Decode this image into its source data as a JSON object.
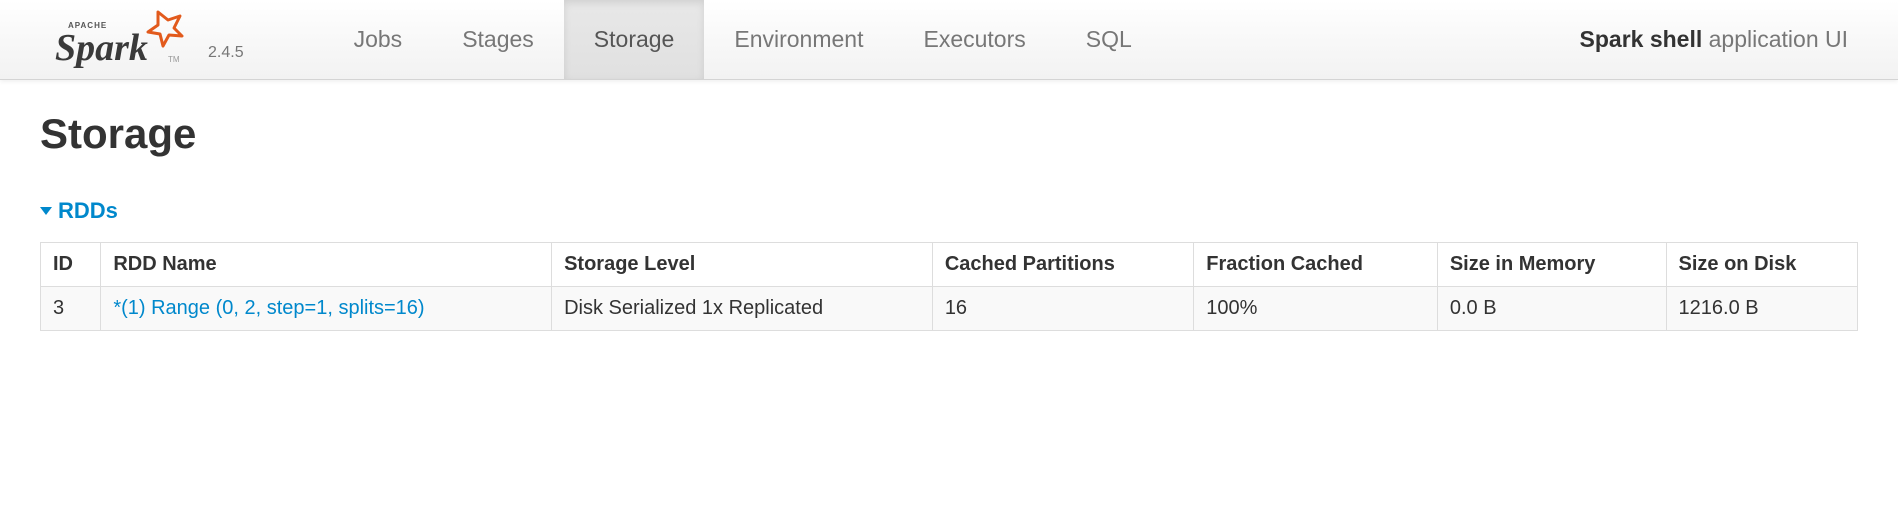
{
  "brand": {
    "name": "Spark",
    "apache": "APACHE",
    "version": "2.4.5"
  },
  "nav": {
    "tabs": [
      {
        "label": "Jobs",
        "active": false
      },
      {
        "label": "Stages",
        "active": false
      },
      {
        "label": "Storage",
        "active": true
      },
      {
        "label": "Environment",
        "active": false
      },
      {
        "label": "Executors",
        "active": false
      },
      {
        "label": "SQL",
        "active": false
      }
    ],
    "app_name": "Spark shell",
    "app_suffix": "application UI"
  },
  "page": {
    "title": "Storage",
    "section_label": "RDDs"
  },
  "table": {
    "headers": [
      "ID",
      "RDD Name",
      "Storage Level",
      "Cached Partitions",
      "Fraction Cached",
      "Size in Memory",
      "Size on Disk"
    ],
    "rows": [
      {
        "id": "3",
        "name": "*(1) Range (0, 2, step=1, splits=16)",
        "storage_level": "Disk Serialized 1x Replicated",
        "cached_partitions": "16",
        "fraction_cached": "100%",
        "size_in_memory": "0.0 B",
        "size_on_disk": "1216.0 B"
      }
    ]
  }
}
